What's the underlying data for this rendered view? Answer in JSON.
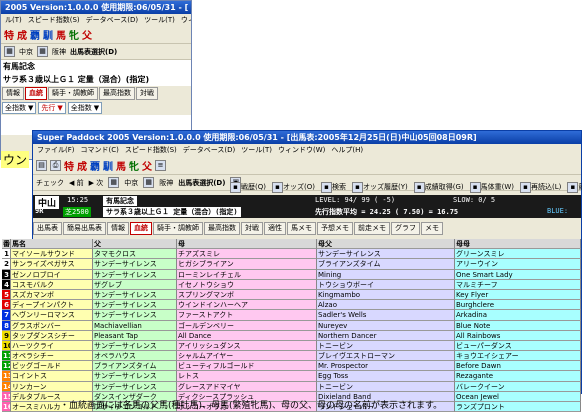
{
  "back_window": {
    "title": "2005 Version:1.0.0.0 使用期限:06/05/31 - [",
    "menu": [
      "ル(T)",
      "スピード指数(S)",
      "データベース(D)",
      "ツール(T)",
      "ウィンド"
    ],
    "kanji_buttons": [
      "特",
      "成",
      "覇",
      "馴",
      "馬",
      "牝",
      "父"
    ],
    "nav": [
      "中京",
      "阪神",
      "出馬表選択(D)"
    ],
    "race_name": "有馬記念",
    "race_condition": "サラ系３歳以上Ｇ１ 定量（混合）(指定)",
    "tabs": [
      "情報",
      "血統",
      "騎手・調教師",
      "最高指数",
      "対戦"
    ],
    "combos": [
      "全指数",
      "先行",
      "全指数"
    ],
    "partial_text": "ウン"
  },
  "front_window": {
    "title": "Super Paddock 2005 Version:1.0.0.0 使用期限:06/05/31 - [出馬表:2005年12月25日(日)中山05回08日09R]",
    "menu": [
      "ファイル(F)",
      "コマンド(C)",
      "スピード指数(S)",
      "データベース(D)",
      "ツール(T)",
      "ウィンドウ(W)",
      "ヘルプ(H)"
    ],
    "kanji_buttons": [
      "特",
      "成",
      "覇",
      "馴",
      "馬",
      "牝",
      "父"
    ],
    "nav": {
      "check": "チェック",
      "back": "前",
      "next": "次",
      "venue1": "中京",
      "venue2": "阪神",
      "select": "出馬表選択(D)"
    },
    "toolbar3": [
      "戦歴(Q)",
      "オッズ(O)",
      "検索",
      "オッズ履歴(Y)",
      "成績取得(G)",
      "馬体重(W)",
      "再読込(L)",
      "競馬"
    ],
    "race": {
      "track": "中山",
      "time": "15:25",
      "race_no": "9R",
      "course": "芝2500",
      "race_name": "有馬記念",
      "condition": "サラ系３歳以上Ｇ１ 定量（混合）(指定)",
      "level": "LEVEL:  94/ 99 ( -5)",
      "slow": "SLOW:  0/ 5",
      "pace": "先行指数平均 = 24.25  ( 7.50) = 16.75",
      "blue": "BLUE:"
    },
    "tabs": [
      "出馬表",
      "簡易出馬表",
      "情報",
      "血統",
      "騎手・調教師",
      "最高指数",
      "対戦",
      "適性",
      "馬メモ",
      "予想メモ",
      "前走メモ",
      "グラフ",
      "メモ"
    ],
    "selected_tab": "血統",
    "columns": [
      "番",
      "馬名",
      "父",
      "母",
      "母父",
      "母母"
    ],
    "rows": [
      {
        "no": "1",
        "horse": "マイソールサウンド",
        "sire": "タマモクロス",
        "dam": "チアズスミレ",
        "damsire": "サンデーサイレンス",
        "damdam": "グリーンスミレ",
        "color": "#ffffff",
        "txt": "#000"
      },
      {
        "no": "2",
        "horse": "サンライズペガサス",
        "sire": "サンデーサイレンス",
        "dam": "ヒガシブライアン",
        "damsire": "ブライアンズタイム",
        "damdam": "アリーウイン",
        "color": "#ffffff",
        "txt": "#000"
      },
      {
        "no": "3",
        "horse": "ゼンノロブロイ",
        "sire": "サンデーサイレンス",
        "dam": "ローミンレイチェル",
        "damsire": "Mining",
        "damdam": "One Smart Lady",
        "color": "#000000",
        "txt": "#fff"
      },
      {
        "no": "4",
        "horse": "コスモバルク",
        "sire": "ザグレブ",
        "dam": "イセノトウショウ",
        "damsire": "トウショウボーイ",
        "damdam": "マルミチーフ",
        "color": "#000000",
        "txt": "#fff"
      },
      {
        "no": "5",
        "horse": "スズカマンボ",
        "sire": "サンデーサイレンス",
        "dam": "スプリングマンボ",
        "damsire": "Kingmambo",
        "damdam": "Key Flyer",
        "color": "#e00000",
        "txt": "#fff"
      },
      {
        "no": "6",
        "horse": "ディープインパクト",
        "sire": "サンデーサイレンス",
        "dam": "ウインドインハーヘア",
        "damsire": "Alzao",
        "damdam": "Burghclere",
        "color": "#e00000",
        "txt": "#fff"
      },
      {
        "no": "7",
        "horse": "ヘヴンリーロマンス",
        "sire": "サンデーサイレンス",
        "dam": "ファーストアクト",
        "damsire": "Sadler's Wells",
        "damdam": "Arkadina",
        "color": "#0030e0",
        "txt": "#fff"
      },
      {
        "no": "8",
        "horse": "グラスボンバー",
        "sire": "Machiavellian",
        "dam": "ゴールデンベリー",
        "damsire": "Nureyev",
        "damdam": "Blue Note",
        "color": "#0030e0",
        "txt": "#fff"
      },
      {
        "no": "9",
        "horse": "タップダンスシチー",
        "sire": "Pleasant Tap",
        "dam": "All Dance",
        "damsire": "Northern Dancer",
        "damdam": "All Rainbows",
        "color": "#f0e000",
        "txt": "#000"
      },
      {
        "no": "10",
        "horse": "ハーツクライ",
        "sire": "サンデーサイレンス",
        "dam": "アイリッシュダンス",
        "damsire": "トニービン",
        "damdam": "ビューパーダンス",
        "color": "#f0e000",
        "txt": "#000"
      },
      {
        "no": "11",
        "horse": "オペラシチー",
        "sire": "オペラハウス",
        "dam": "シャルムアイヤー",
        "damsire": "ブレイヴエストローマン",
        "damdam": "キョウエイシェアー",
        "color": "#00a000",
        "txt": "#fff"
      },
      {
        "no": "12",
        "horse": "ビッグゴールド",
        "sire": "ブライアンズタイム",
        "dam": "ビューティフルゴールド",
        "damsire": "Mr. Prospector",
        "damdam": "Before Dawn",
        "color": "#00a000",
        "txt": "#fff"
      },
      {
        "no": "13",
        "horse": "コイントス",
        "sire": "サンデーサイレンス",
        "dam": "レトス",
        "damsire": "Egg Toss",
        "damdam": "Rezagante",
        "color": "#ff8000",
        "txt": "#fff"
      },
      {
        "no": "14",
        "horse": "リンカーン",
        "sire": "サンデーサイレンス",
        "dam": "グレースアドマイヤ",
        "damsire": "トニービン",
        "damdam": "バレークイーン",
        "color": "#ff8000",
        "txt": "#fff"
      },
      {
        "no": "15",
        "horse": "デルタブルース",
        "sire": "ダンスインザダーク",
        "dam": "ディクシースプラッシュ",
        "damsire": "Dixieland Band",
        "damdam": "Ocean Jewel",
        "color": "#ff60b0",
        "txt": "#fff"
      },
      {
        "no": "16",
        "horse": "オースミハルカ",
        "sire": "フサイチコンコルド",
        "dam": "ホッコーオウカ",
        "damsire": "リンドシェーバー",
        "damdam": "ランズプロント",
        "color": "#ff60b0",
        "txt": "#fff"
      }
    ]
  },
  "colors": {
    "horse_col": "#ffffb0",
    "sire_col": "#c8ffc8",
    "dam_col": "#ffc8f0",
    "damsire_col": "#d8d8ff",
    "damdam_col": "#a8ffff"
  },
  "caption": "・血統画面には各馬の父馬(種牡馬)、母馬(繁殖牝馬)、母の父、母の母の名前が表示されます。"
}
